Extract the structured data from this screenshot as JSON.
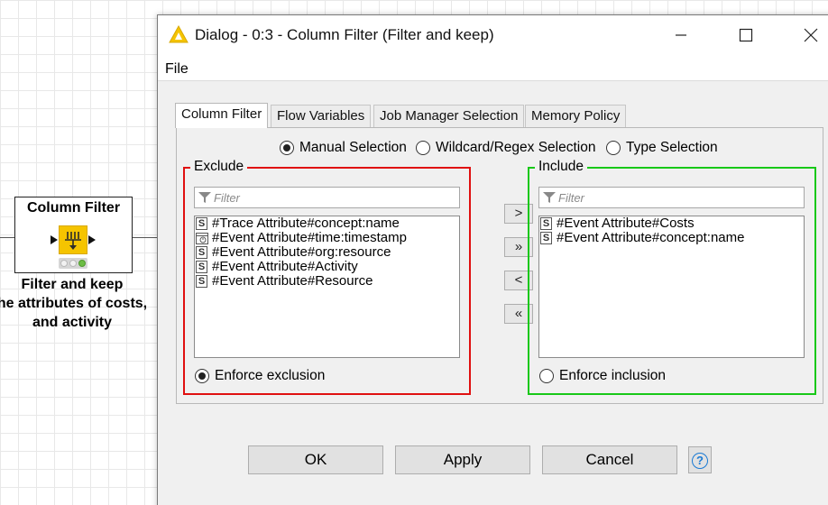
{
  "canvas": {
    "node": {
      "title": "Column Filter",
      "caption_lines": [
        "Filter and keep",
        "he attributes of costs,",
        "and activity"
      ],
      "icon": "column-filter-icon",
      "accent_color": "#f5c400"
    }
  },
  "dialog": {
    "title": "Dialog - 0:3 - Column Filter (Filter and keep)",
    "menu": {
      "file": "File"
    },
    "tabs": [
      {
        "label": "Column Filter",
        "active": true
      },
      {
        "label": "Flow Variables",
        "active": false
      },
      {
        "label": "Job Manager Selection",
        "active": false
      },
      {
        "label": "Memory Policy",
        "active": false
      }
    ],
    "selection_modes": [
      {
        "label": "Manual Selection",
        "selected": true
      },
      {
        "label": "Wildcard/Regex Selection",
        "selected": false
      },
      {
        "label": "Type Selection",
        "selected": false
      }
    ],
    "exclude": {
      "title": "Exclude",
      "border_color": "#e01010",
      "filter_placeholder": "Filter",
      "items": [
        {
          "label": "#Trace Attribute#concept:name",
          "type": "S"
        },
        {
          "label": "#Event Attribute#time:timestamp",
          "type": "date"
        },
        {
          "label": "#Event Attribute#org:resource",
          "type": "S"
        },
        {
          "label": "#Event Attribute#Activity",
          "type": "S"
        },
        {
          "label": "#Event Attribute#Resource",
          "type": "S"
        }
      ],
      "enforce_label": "Enforce exclusion",
      "enforce_selected": true
    },
    "include": {
      "title": "Include",
      "border_color": "#18c818",
      "filter_placeholder": "Filter",
      "items": [
        {
          "label": "#Event Attribute#Costs",
          "type": "S"
        },
        {
          "label": "#Event Attribute#concept:name",
          "type": "S"
        }
      ],
      "enforce_label": "Enforce inclusion",
      "enforce_selected": false
    },
    "move_buttons": {
      "add": ">",
      "add_all": "»",
      "remove": "<",
      "remove_all": "«"
    },
    "buttons": {
      "ok": "OK",
      "apply": "Apply",
      "cancel": "Cancel",
      "help": "?"
    }
  }
}
